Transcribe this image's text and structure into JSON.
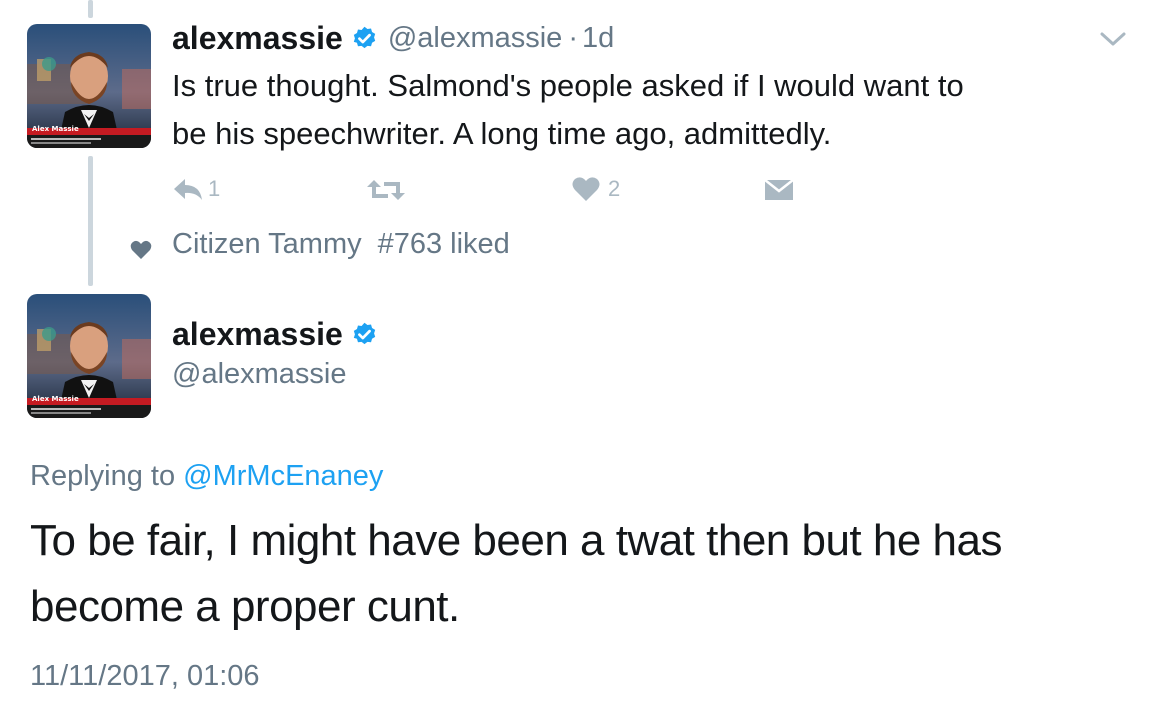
{
  "tweet1": {
    "display_name": "alexmassie",
    "handle": "@alexmassie",
    "separator": "·",
    "time": "1d",
    "text_line1": "Is true thought. Salmond's people asked if I would want to",
    "text_line2": "be his speechwriter. A long time ago, admittedly.",
    "avatar_name": "Alex Massie",
    "actions": {
      "reply_icon": "reply-icon",
      "reply_count": "1",
      "retweet_icon": "retweet-icon",
      "like_icon": "heart-icon",
      "like_count": "2",
      "dm_icon": "envelope-icon"
    }
  },
  "liked_by": {
    "icon": "heart-icon",
    "name": "Citizen Tammy",
    "tag": "#763",
    "suffix": "liked"
  },
  "tweet2": {
    "display_name": "alexmassie",
    "handle": "@alexmassie",
    "avatar_name": "Alex Massie",
    "replying_prefix": "Replying to",
    "replying_to": "@MrMcEnaney",
    "text_line1": "To be fair, I might have been a twat then but he has",
    "text_line2": "become a proper cunt.",
    "timestamp": "11/11/2017, 01:06"
  },
  "colors": {
    "primary_text": "#14171a",
    "secondary_text": "#657786",
    "icon_gray": "#aab8c2",
    "link_blue": "#1da1f2",
    "verified_blue": "#1da1f2",
    "thread_line": "#ccd6dd"
  }
}
